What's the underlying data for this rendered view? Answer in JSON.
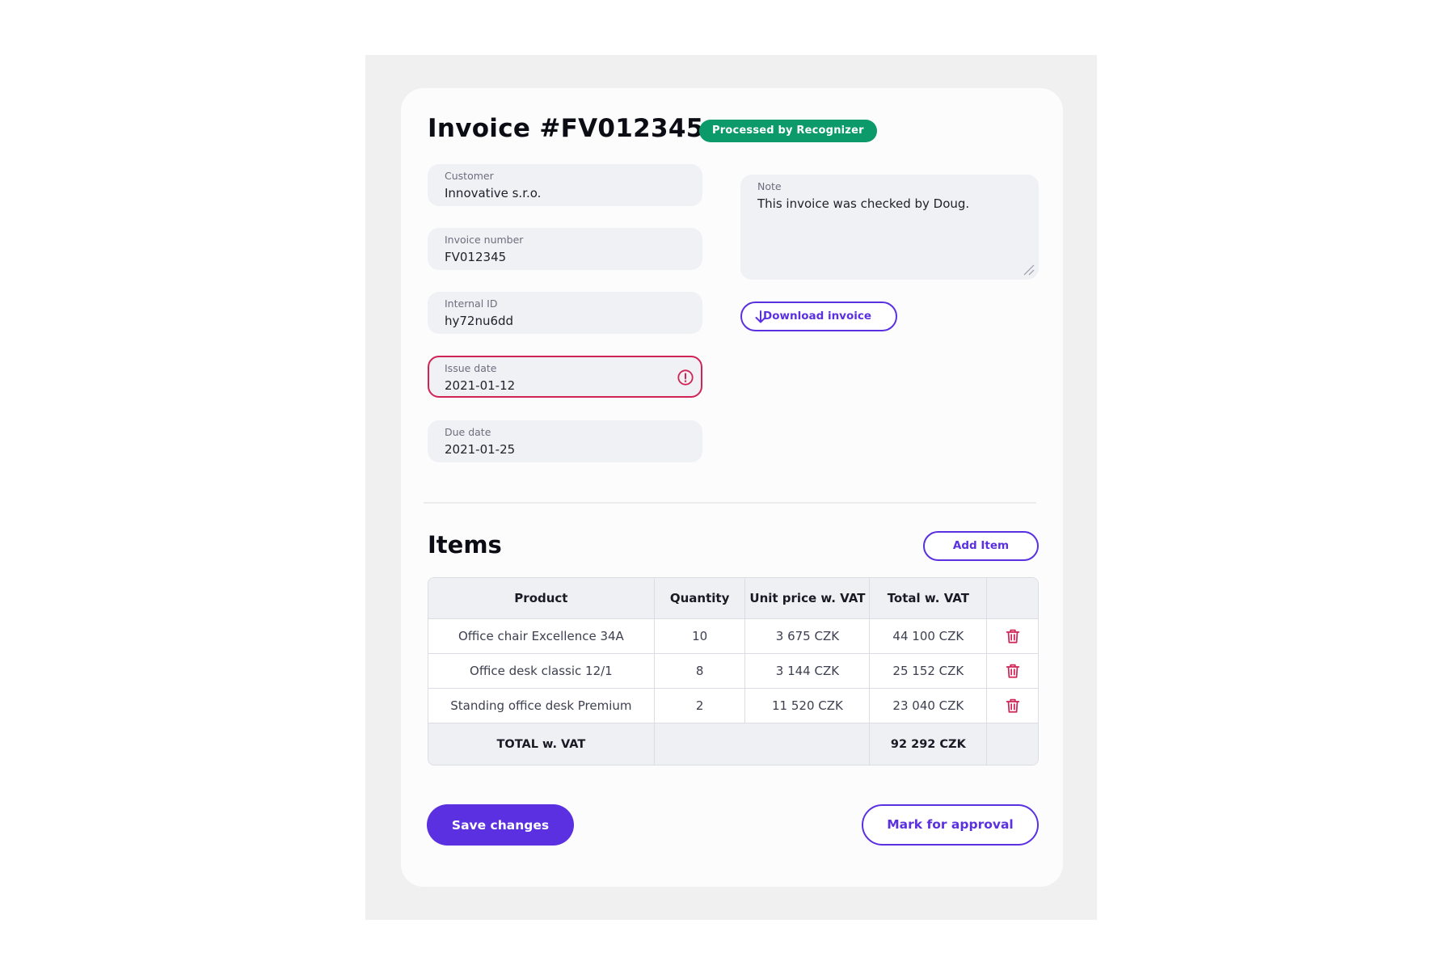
{
  "invoice": {
    "title": "Invoice #FV012345",
    "badge": "Processed by Recognizer"
  },
  "fields": {
    "customer": {
      "label": "Customer",
      "value": "Innovative s.r.o."
    },
    "invoice_number": {
      "label": "Invoice number",
      "value": "FV012345"
    },
    "internal_id": {
      "label": "Internal ID",
      "value": "hy72nu6dd"
    },
    "issue_date": {
      "label": "Issue date",
      "value": "2021-01-12"
    },
    "due_date": {
      "label": "Due date",
      "value": "2021-01-25"
    }
  },
  "note": {
    "label": "Note",
    "value": "This invoice was checked by Doug."
  },
  "buttons": {
    "download": "Download invoice",
    "add_item": "Add Item",
    "save": "Save changes",
    "approval": "Mark for approval"
  },
  "items": {
    "title": "Items",
    "columns": [
      "Product",
      "Quantity",
      "Unit price w. VAT",
      "Total w. VAT"
    ],
    "rows": [
      {
        "product": "Office chair Excellence 34A",
        "quantity": "10",
        "unit_price": "3 675 CZK",
        "total": "44 100 CZK"
      },
      {
        "product": "Office desk classic 12/1",
        "quantity": "8",
        "unit_price": "3 144 CZK",
        "total": "25 152 CZK"
      },
      {
        "product": "Standing office desk Premium",
        "quantity": "2",
        "unit_price": "11 520 CZK",
        "total": "23 040 CZK"
      }
    ],
    "total_label": "TOTAL w. VAT",
    "total_value": "92 292 CZK"
  },
  "icons": {
    "error": "exclamation-circle-icon",
    "download": "arrow-down-icon",
    "delete": "trash-icon",
    "resize": "resize-handle-icon"
  },
  "colors": {
    "accent": "#5a30e0",
    "badge": "#0c9a6a",
    "error": "#cf2455"
  }
}
